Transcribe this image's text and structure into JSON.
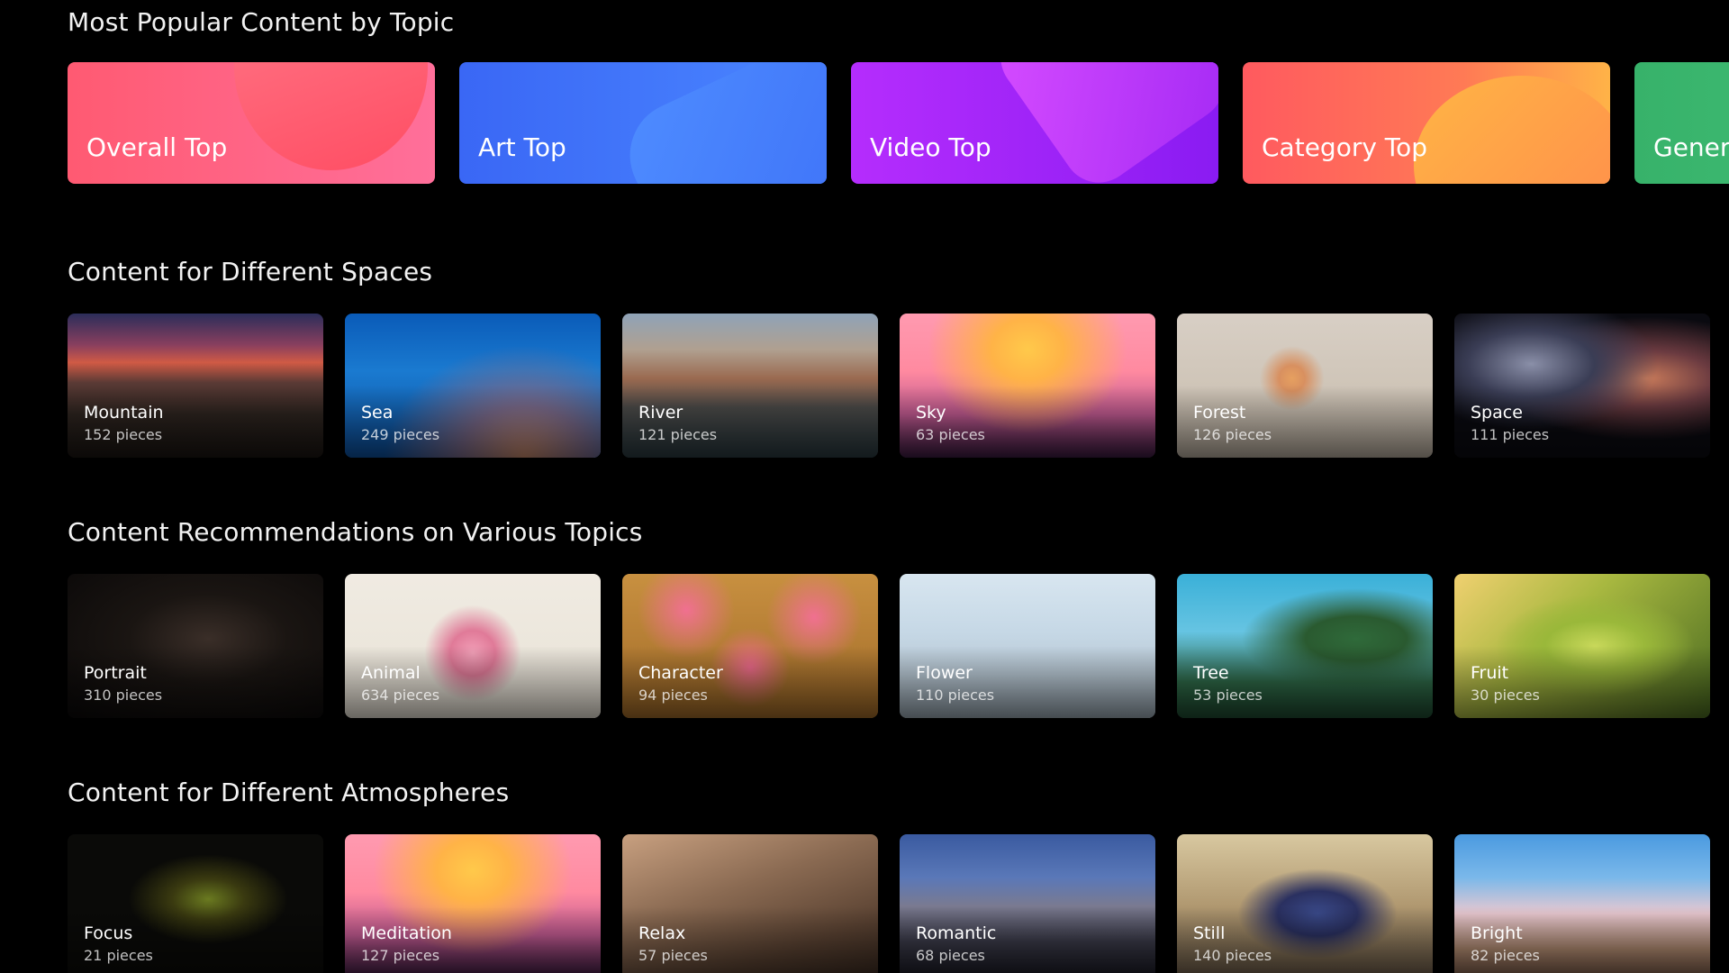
{
  "sections": {
    "popular": {
      "title": "Most Popular Content by Topic",
      "cards": [
        {
          "label": "Overall Top",
          "colors": [
            "#ff5f6d",
            "#ff7eb3"
          ]
        },
        {
          "label": "Art Top",
          "colors": [
            "#3b6cf6",
            "#4f8dff"
          ]
        },
        {
          "label": "Video Top",
          "colors": [
            "#b22cff",
            "#8f1cf0"
          ]
        },
        {
          "label": "Category Top",
          "colors": [
            "#ff5e62",
            "#ff9966"
          ]
        },
        {
          "label": "Genera",
          "colors": [
            "#3cb46e",
            "#45c27a"
          ]
        }
      ]
    },
    "spaces": {
      "title": "Content for Different Spaces",
      "tiles": [
        {
          "name": "Mountain",
          "count": "152 pieces"
        },
        {
          "name": "Sea",
          "count": "249 pieces"
        },
        {
          "name": "River",
          "count": "121 pieces"
        },
        {
          "name": "Sky",
          "count": "63 pieces"
        },
        {
          "name": "Forest",
          "count": "126 pieces"
        },
        {
          "name": "Space",
          "count": "111 pieces"
        }
      ]
    },
    "topics": {
      "title": "Content Recommendations on Various Topics",
      "tiles": [
        {
          "name": "Portrait",
          "count": "310 pieces"
        },
        {
          "name": "Animal",
          "count": "634 pieces"
        },
        {
          "name": "Character",
          "count": "94 pieces"
        },
        {
          "name": "Flower",
          "count": "110 pieces"
        },
        {
          "name": "Tree",
          "count": "53 pieces"
        },
        {
          "name": "Fruit",
          "count": "30 pieces"
        }
      ]
    },
    "atmospheres": {
      "title": "Content for Different Atmospheres",
      "tiles": [
        {
          "name": "Focus",
          "count": "21 pieces"
        },
        {
          "name": "Meditation",
          "count": "127 pieces"
        },
        {
          "name": "Relax",
          "count": "57 pieces"
        },
        {
          "name": "Romantic",
          "count": "68 pieces"
        },
        {
          "name": "Still",
          "count": "140 pieces"
        },
        {
          "name": "Bright",
          "count": "82 pieces"
        }
      ]
    }
  }
}
